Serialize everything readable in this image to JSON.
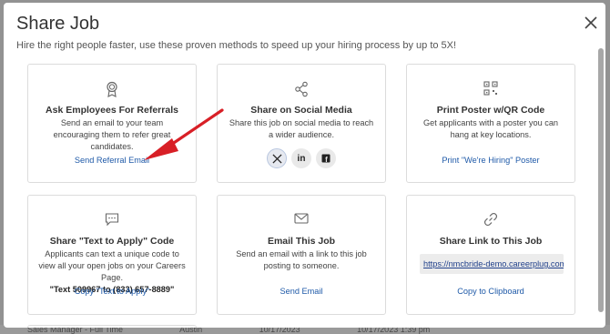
{
  "background": {
    "row_text": [
      "Sales Manager - Full Time",
      "Austin",
      "10/17/2023",
      "10/17/2023 1:39 pm"
    ]
  },
  "modal": {
    "title": "Share Job",
    "subtitle": "Hire the right people faster, use these proven methods to speed up your hiring process by up to 5X!",
    "close_icon": "close-icon"
  },
  "cards": [
    {
      "icon": "award-ribbon-icon",
      "title": "Ask Employees For Referrals",
      "desc": "Send an email to your team encouraging them to refer great candidates.",
      "link": "Send Referral Email"
    },
    {
      "icon": "share-icon",
      "title": "Share on Social Media",
      "desc": "Share this job on social media to reach a wider audience.",
      "social": [
        {
          "icon": "x-twitter-icon",
          "glyph": "𝕏"
        },
        {
          "icon": "linkedin-icon",
          "glyph": "in"
        },
        {
          "icon": "facebook-icon",
          "glyph": "f"
        }
      ]
    },
    {
      "icon": "qr-code-icon",
      "title": "Print Poster w/QR Code",
      "desc": "Get applicants with a poster you can hang at key locations.",
      "link": "Print \"We're Hiring\" Poster"
    },
    {
      "icon": "chat-bubble-icon",
      "title": "Share \"Text to Apply\" Code",
      "desc": "Applicants can text a unique code to view all your open jobs on your Careers Page.",
      "strong": "\"Text 509967 to (833) 657-8889\"",
      "link": "Copy \"Text to Apply\""
    },
    {
      "icon": "envelope-icon",
      "title": "Email This Job",
      "desc": "Send an email with a link to this job posting to someone.",
      "link": "Send Email"
    },
    {
      "icon": "link-icon",
      "title": "Share Link to This Job",
      "url": "https://nmcbride-demo.careerplug.com/jo",
      "link": "Copy to Clipboard"
    }
  ],
  "colors": {
    "link": "#1f5aa8",
    "arrow": "#d81f26"
  }
}
